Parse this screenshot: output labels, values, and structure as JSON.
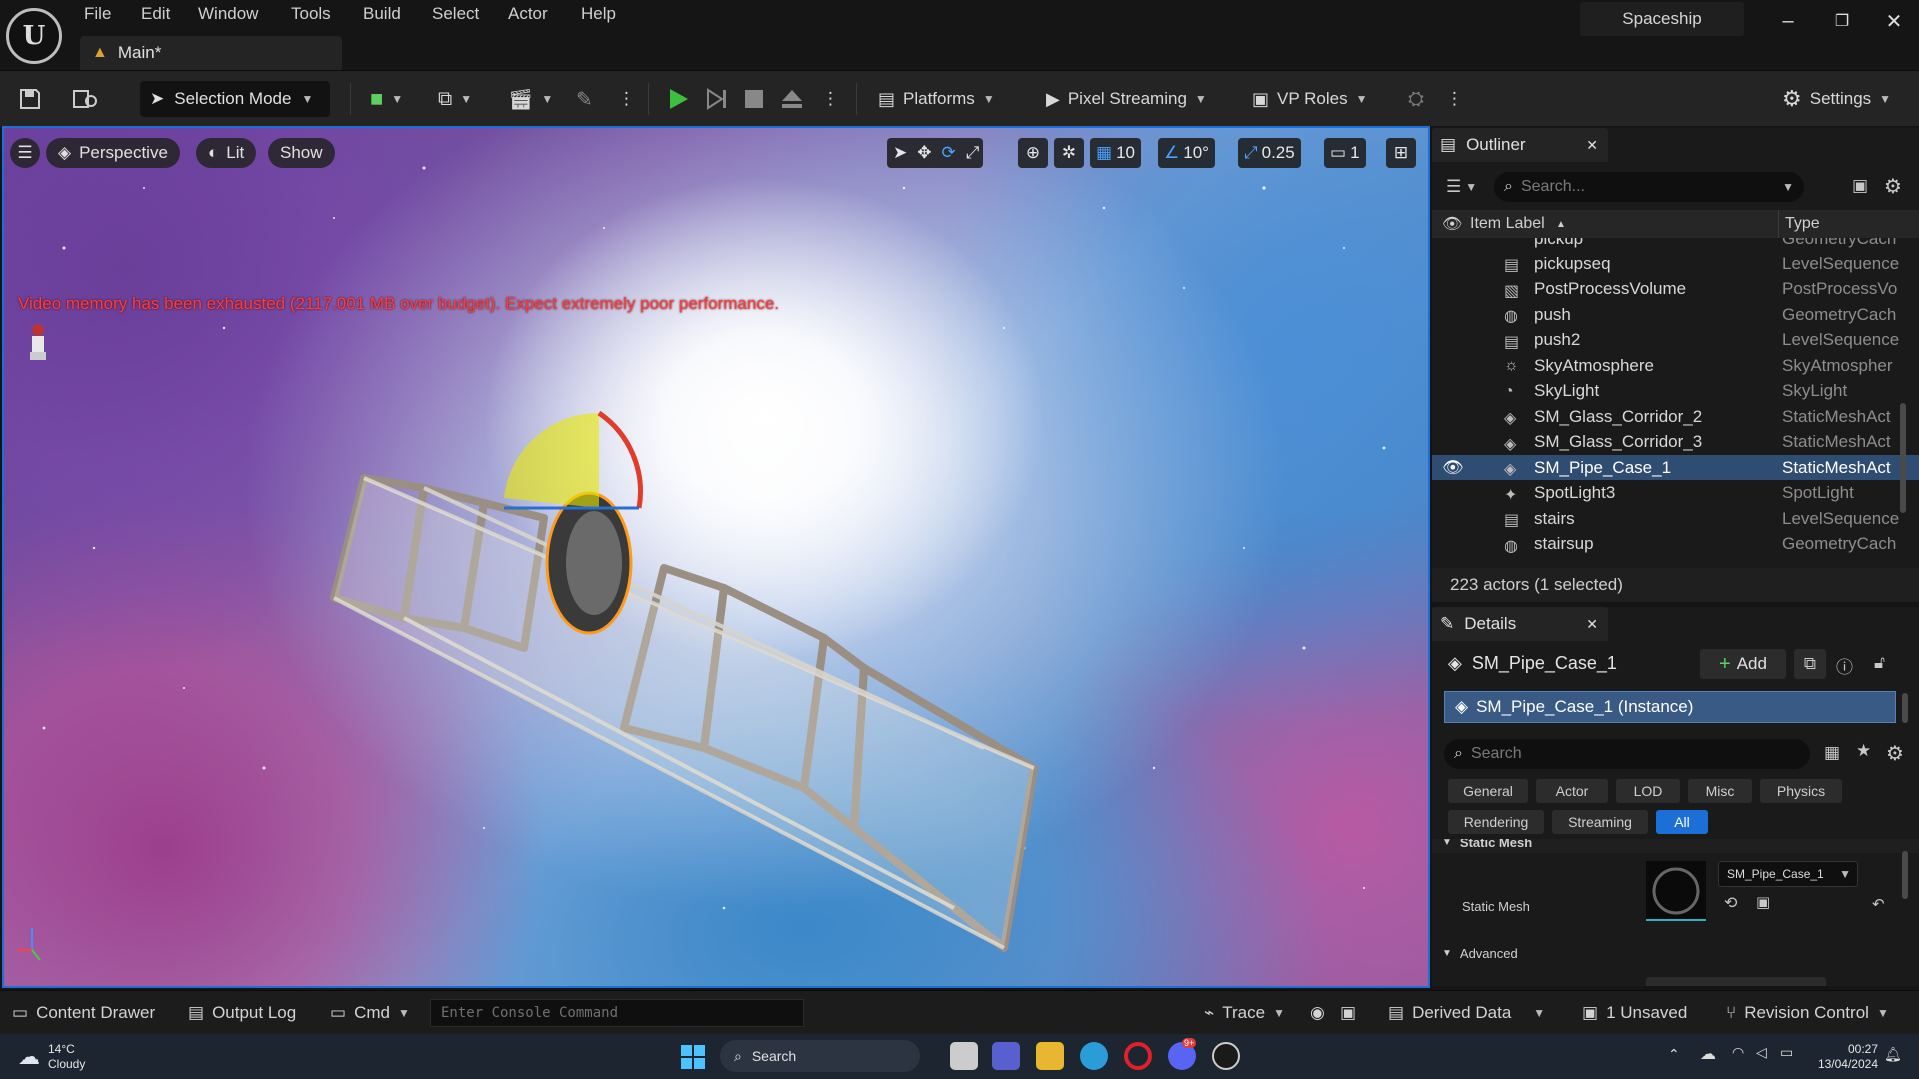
{
  "app": {
    "menus": [
      "File",
      "Edit",
      "Window",
      "Tools",
      "Build",
      "Select",
      "Actor",
      "Help"
    ],
    "tab_label": "Main*",
    "project_name": "Spaceship"
  },
  "toolbar": {
    "selection_mode": "Selection Mode",
    "platforms": "Platforms",
    "pixel_streaming": "Pixel Streaming",
    "vp_roles": "VP Roles",
    "settings": "Settings"
  },
  "viewport": {
    "perspective": "Perspective",
    "lit": "Lit",
    "show": "Show",
    "grid_snap": "10",
    "rot_snap": "10°",
    "scale_snap": "0.25",
    "camera_speed": "1",
    "warning": "Video memory has been exhausted (2117.001 MB over budget). Expect extremely poor performance."
  },
  "outliner": {
    "title": "Outliner",
    "search_placeholder": "Search...",
    "col_label": "Item Label",
    "col_type": "Type",
    "partial_top": {
      "label": "pickup",
      "type": "GeometryCach"
    },
    "rows": [
      {
        "label": "pickupseq",
        "type": "LevelSequence",
        "icon": "sequence-icon"
      },
      {
        "label": "PostProcessVolume",
        "type": "PostProcessVo",
        "icon": "volume-icon"
      },
      {
        "label": "push",
        "type": "GeometryCach",
        "icon": "geometry-cache-icon"
      },
      {
        "label": "push2",
        "type": "LevelSequence",
        "icon": "sequence-icon"
      },
      {
        "label": "SkyAtmosphere",
        "type": "SkyAtmospher",
        "icon": "sky-atmosphere-icon"
      },
      {
        "label": "SkyLight",
        "type": "SkyLight",
        "icon": "sky-light-icon"
      },
      {
        "label": "SM_Glass_Corridor_2",
        "type": "StaticMeshAct",
        "icon": "static-mesh-icon"
      },
      {
        "label": "SM_Glass_Corridor_3",
        "type": "StaticMeshAct",
        "icon": "static-mesh-icon"
      },
      {
        "label": "SM_Pipe_Case_1",
        "type": "StaticMeshAct",
        "icon": "static-mesh-icon",
        "selected": true
      },
      {
        "label": "SpotLight3",
        "type": "SpotLight",
        "icon": "spot-light-icon"
      },
      {
        "label": "stairs",
        "type": "LevelSequence",
        "icon": "sequence-icon"
      },
      {
        "label": "stairsup",
        "type": "GeometryCach",
        "icon": "geometry-cache-icon"
      }
    ],
    "status": "223 actors (1 selected)"
  },
  "details": {
    "title": "Details",
    "actor_name": "SM_Pipe_Case_1",
    "add_label": "Add",
    "instance_label": "SM_Pipe_Case_1 (Instance)",
    "search_placeholder": "Search",
    "filters_row1": [
      "General",
      "Actor",
      "LOD",
      "Misc",
      "Physics"
    ],
    "filters_row2": [
      "Rendering",
      "Streaming",
      "All"
    ],
    "active_filter": "All",
    "section_static_mesh": "Static Mesh",
    "prop_static_mesh": "Static Mesh",
    "mesh_value": "SM_Pipe_Case_1",
    "section_advanced": "Advanced"
  },
  "bottombar": {
    "content_drawer": "Content Drawer",
    "output_log": "Output Log",
    "cmd": "Cmd",
    "console_placeholder": "Enter Console Command",
    "trace": "Trace",
    "derived_data": "Derived Data",
    "unsaved": "1 Unsaved",
    "revision_control": "Revision Control"
  },
  "taskbar": {
    "weather_temp": "14°C",
    "weather_desc": "Cloudy",
    "search": "Search",
    "time": "00:27",
    "date": "13/04/2024",
    "badge": "9+"
  },
  "colors": {
    "accent": "#1b6fd6",
    "selected_row": "#2f4d72",
    "warning": "#ff3c3c",
    "play_green": "#3fbf3f"
  }
}
